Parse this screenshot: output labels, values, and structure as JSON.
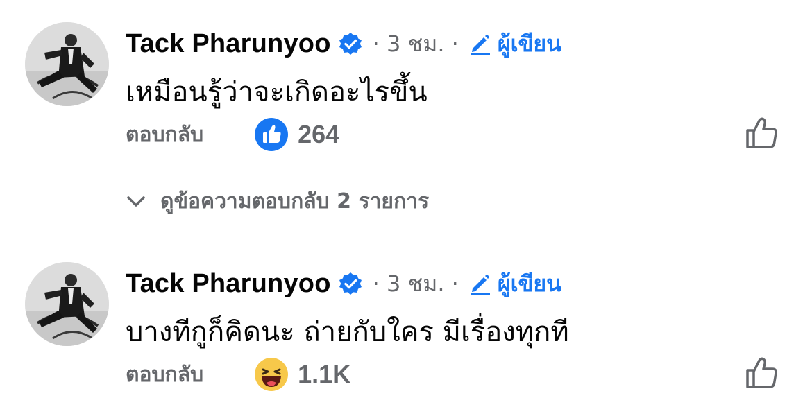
{
  "comments": [
    {
      "author": "Tack Pharunyoo",
      "time": "· 3 ชม. ·",
      "author_badge": "ผู้เขียน",
      "text": "เหมือนรู้ว่าจะเกิดอะไรขึ้น",
      "reply_label": "ตอบกลับ",
      "reaction_icon": "like-icon",
      "reaction_count": "264",
      "view_replies": "ดูข้อความตอบกลับ 2 รายการ"
    },
    {
      "author": "Tack Pharunyoo",
      "time": "· 3 ชม. ·",
      "author_badge": "ผู้เขียน",
      "text": "บางทีกูก็คิดนะ ถ่ายกับใคร มีเรื่องทุกที",
      "reply_label": "ตอบกลับ",
      "reaction_icon": "haha-icon",
      "reaction_count": "1.1K"
    }
  ],
  "colors": {
    "accent": "#1877f2",
    "secondary_text": "#65676b",
    "primary_text": "#050505",
    "haha_yellow": "#f7c84a"
  }
}
